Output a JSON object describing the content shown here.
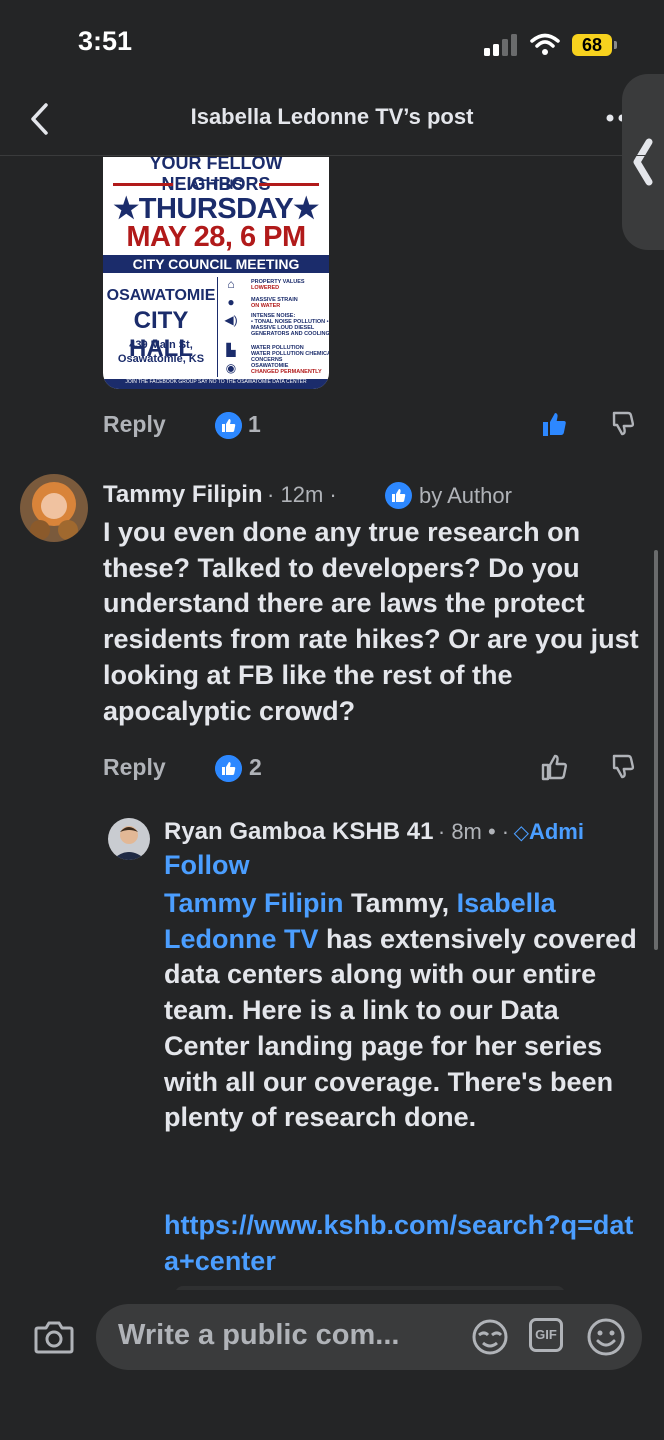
{
  "status_bar": {
    "time": "3:51",
    "battery": "68"
  },
  "header": {
    "title": "Isabella Ledonne TV’s post"
  },
  "flyer": {
    "line1": "YOUR FELLOW NEIGHBORS",
    "line2": "AT THIS",
    "line3": "★THURSDAY★",
    "line4": "MAY 28, 6 PM",
    "band": "CITY COUNCIL MEETING",
    "place1": "OSAWATOMIE",
    "place2": "CITY HALL",
    "addr1": "439 Main St,",
    "addr2": "Osawatomie, KS",
    "items": [
      {
        "a": "PROPERTY VALUES",
        "b": "LOWERED"
      },
      {
        "a": "MASSIVE STRAIN",
        "b": "ON WATER"
      },
      {
        "a": "INTENSE NOISE:",
        "b": "• TONAL NOISE POLLUTION • MASSIVE LOUD DIESEL GENERATORS AND COOLING FANS"
      },
      {
        "a": "WATER POLLUTION",
        "b": "WATER POLLUTION CHEMICAL CONCERNS"
      },
      {
        "a": "OSAWATOMIE",
        "b": "CHANGED PERMANENTLY"
      }
    ],
    "footer": "JOIN THE FACEBOOK GROUP SAY NO TO THE OSAWATOMIE DATA CENTER"
  },
  "comment1_actions": {
    "reply": "Reply",
    "like_count": "1"
  },
  "comment2": {
    "author": "Tammy Filipin",
    "time": "· 12m ·",
    "author_badge": "by Author",
    "text": "I you even done any true research on these? Talked to developers? Do you understand there are laws the protect residents from rate hikes? Or are you just looking at FB like the rest of the apocalyptic crowd?",
    "reply": "Reply",
    "like_count": "2"
  },
  "comment3": {
    "author": "Ryan Gamboa KSHB 41",
    "time": "· 8m • ·",
    "badge": "Admi",
    "follow": "Follow",
    "mention1": "Tammy Filipin",
    "text1": " Tammy, ",
    "mention2": "Isabella Ledonne TV",
    "text2": " has extensively covered data centers along with our entire team. Here is a link to our Data Center landing page for her series with all our coverage. There's been plenty of research done.",
    "link": "https://www.kshb.com/search?q=data+center"
  },
  "composer": {
    "placeholder": "Write a public com..."
  },
  "colors": {
    "background": "#242526",
    "accent": "#2d88ff",
    "link": "#4b9eff"
  },
  "icons": [
    "back-icon",
    "more-icon",
    "like-icon",
    "dislike-icon",
    "camera-icon",
    "avatar-sticker-icon",
    "gif-icon",
    "emoji-icon"
  ]
}
